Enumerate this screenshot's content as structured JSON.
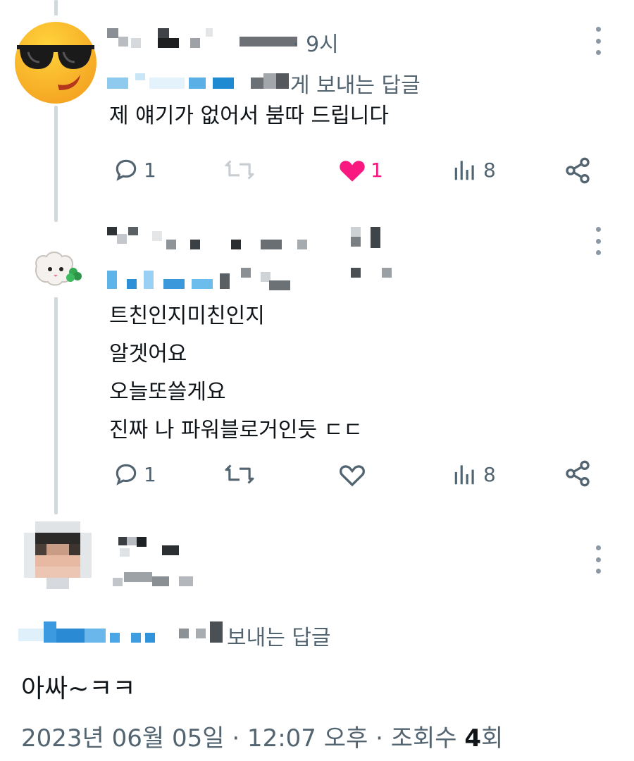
{
  "tweets": [
    {
      "time": "· 9시",
      "reply_to_suffix": "게 보내는 답글",
      "text_lines": [
        "제 얘기가 없어서 붐따 드립니다"
      ],
      "reply_count": "1",
      "retweet_count": "",
      "like_count": "1",
      "view_count": "8",
      "liked": true
    },
    {
      "text_lines": [
        "트친인지미친인지",
        "알겟어요",
        "오늘또쓸게요",
        "진짜 나 파워블로거인듯 ㄷㄷ"
      ],
      "reply_count": "1",
      "retweet_count": "",
      "like_count": "",
      "view_count": "8",
      "liked": false
    }
  ],
  "main_tweet": {
    "reply_to_suffix": "보내는 답글",
    "text": "아싸~ㅋㅋ",
    "date_time": "2023년 06월 05일 · 12:07 오후 · 조회수 ",
    "view_count": "4",
    "view_unit": "회"
  },
  "colors": {
    "like": "#f91880",
    "muted": "#536471",
    "thread_line": "#cfd9de",
    "link_blue": "#1d9bf0"
  },
  "icons": [
    "reply-icon",
    "retweet-icon",
    "heart-icon",
    "views-icon",
    "share-icon",
    "more-icon"
  ]
}
